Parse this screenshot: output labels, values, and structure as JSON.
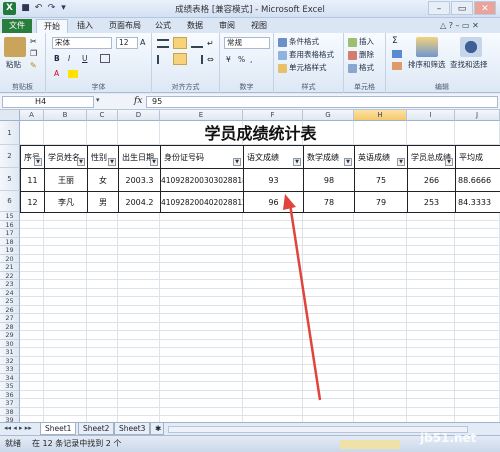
{
  "window": {
    "title": "成绩表格 [兼容模式] - Microsoft Excel",
    "logo": "X",
    "minimize": "–",
    "maximize": "▭",
    "close": "✕"
  },
  "tabs": [
    "文件",
    "开始",
    "插入",
    "页面布局",
    "公式",
    "数据",
    "审阅",
    "视图"
  ],
  "ribbon": {
    "clipboard": {
      "paste": "粘贴",
      "label": "剪贴板"
    },
    "font": {
      "name": "宋体",
      "size": "12",
      "label": "字体",
      "bold": "B",
      "italic": "I",
      "underline": "U",
      "fontcolor": "A",
      "grow": "A",
      "shrink": "A"
    },
    "alignment": {
      "label": "对齐方式"
    },
    "number": {
      "format": "常规",
      "label": "数字",
      "percent": "%",
      "comma": ",",
      "currency": "¥"
    },
    "styles": {
      "conditional": "条件格式",
      "table": "套用表格格式",
      "cell": "单元格样式",
      "label": "样式"
    },
    "cells": {
      "insert": "插入",
      "delete": "删除",
      "format": "格式",
      "label": "单元格"
    },
    "editing": {
      "sortfilter": "排序和筛选",
      "findselect": "查找和选择",
      "label": "编辑",
      "sum": "Σ"
    }
  },
  "formula_bar": {
    "name_box": "H4",
    "fx": "fx",
    "value": "95"
  },
  "columns": [
    "A",
    "B",
    "C",
    "D",
    "E",
    "F",
    "G",
    "H",
    "I",
    "J"
  ],
  "rows": [
    "1",
    "2",
    "5",
    "6",
    "15",
    "16",
    "17",
    "18",
    "19",
    "20",
    "21",
    "22",
    "23",
    "24",
    "25",
    "26",
    "27",
    "28",
    "29",
    "30",
    "31",
    "32",
    "33",
    "34",
    "35",
    "36",
    "37",
    "38",
    "39",
    "40",
    "41"
  ],
  "sheet_title": "学员成绩统计表",
  "headers": [
    "序号",
    "学员姓名",
    "性别",
    "出生日期",
    "身份证号码",
    "语文成绩",
    "数学成绩",
    "英语成绩",
    "学员总成绩",
    "平均成"
  ],
  "data_rows": [
    [
      "11",
      "王丽",
      "女",
      "2003.3",
      "410928200303028818",
      "93",
      "98",
      "75",
      "266",
      "88.6666"
    ],
    [
      "12",
      "李凡",
      "男",
      "2004.2",
      "410928200402028812",
      "96",
      "78",
      "79",
      "253",
      "84.3333"
    ]
  ],
  "sheet_tabs": [
    "Sheet1",
    "Sheet2",
    "Sheet3"
  ],
  "status": {
    "ready": "就绪",
    "message": "在 12 条记录中找到 2 个"
  },
  "watermark": "jb51.net"
}
